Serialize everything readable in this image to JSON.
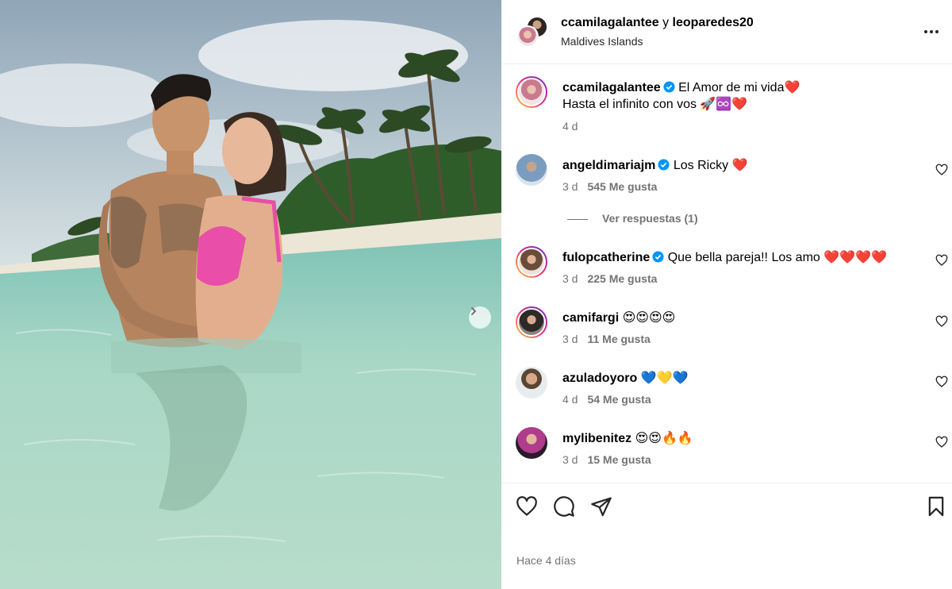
{
  "header": {
    "user1": "ccamilagalantee",
    "conjunction": "y",
    "user2": "leoparedes20",
    "location": "Maldives Islands"
  },
  "caption": {
    "username": "ccamilagalantee",
    "line1": "El Amor de mi vida❤️",
    "line2": "Hasta el infinito con vos 🚀♾️❤️",
    "time": "4 d"
  },
  "comments": [
    {
      "username": "angeldimariajm",
      "verified": true,
      "text": "Los Ricky ❤️",
      "time": "3 d",
      "likes": "545 Me gusta"
    },
    {
      "username": "fulopcatherine",
      "verified": true,
      "text": "Que bella pareja!! Los amo ❤️❤️❤️❤️",
      "time": "3 d",
      "likes": "225 Me gusta"
    },
    {
      "username": "camifargi",
      "verified": false,
      "text": "😍😍😍😍",
      "time": "3 d",
      "likes": "11 Me gusta"
    },
    {
      "username": "azuladoyoro",
      "verified": false,
      "text": "💙💛💙",
      "time": "4 d",
      "likes": "54 Me gusta"
    },
    {
      "username": "mylibenitez",
      "verified": false,
      "text": "😍😍🔥🔥",
      "time": "3 d",
      "likes": "15 Me gusta"
    }
  ],
  "replies_label": "Ver respuestas (1)",
  "footer": {
    "time_ago": "Hace 4 días"
  },
  "colors": {
    "verified": "#0095f6",
    "meta": "#737373",
    "divider": "#efefef"
  }
}
